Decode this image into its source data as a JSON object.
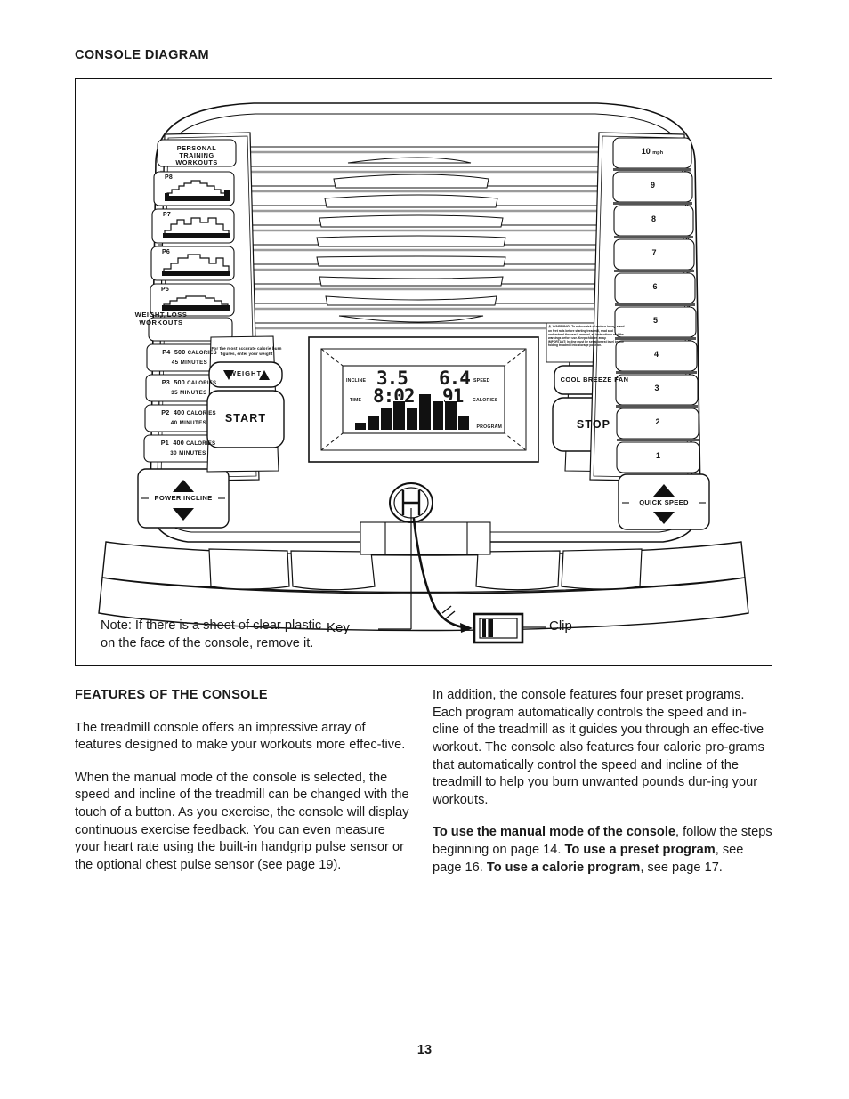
{
  "section_title": "CONSOLE DIAGRAM",
  "page_number": "13",
  "diagram": {
    "personal_training_header": "PERSONAL\nTRAINING\nWORKOUTS",
    "personal_training_header_lines": [
      "PERSONAL",
      "TRAINING",
      "WORKOUTS"
    ],
    "weight_loss_header_lines": [
      "WEIGHT LOSS",
      "WORKOUTS"
    ],
    "preset_programs": [
      {
        "id": "P8",
        "label": "P8"
      },
      {
        "id": "P7",
        "label": "P7"
      },
      {
        "id": "P6",
        "label": "P6"
      },
      {
        "id": "P5",
        "label": "P5"
      }
    ],
    "calorie_programs": [
      {
        "id": "P4",
        "calories": "500",
        "calories_word": "CALORIES",
        "minutes": "45 MINUTES"
      },
      {
        "id": "P3",
        "calories": "500",
        "calories_word": "CALORIES",
        "minutes": "35 MINUTES"
      },
      {
        "id": "P2",
        "calories": "400",
        "calories_word": "CALORIES",
        "minutes": "40 MINUTES"
      },
      {
        "id": "P1",
        "calories": "400",
        "calories_word": "CALORIES",
        "minutes": "30 MINUTES"
      }
    ],
    "power_incline_label": "POWER INCLINE",
    "quick_speed_label": "QUICK SPEED",
    "speed_buttons": [
      {
        "value": "10",
        "unit": "mph"
      },
      {
        "value": "9",
        "unit": ""
      },
      {
        "value": "8",
        "unit": ""
      },
      {
        "value": "7",
        "unit": ""
      },
      {
        "value": "6",
        "unit": ""
      },
      {
        "value": "5",
        "unit": ""
      },
      {
        "value": "4",
        "unit": ""
      },
      {
        "value": "3",
        "unit": ""
      },
      {
        "value": "2",
        "unit": ""
      },
      {
        "value": "1",
        "unit": ""
      }
    ],
    "weight_button_label": "WEIGHT",
    "weight_note": "For the most accurate calorie burn figures, enter your weight",
    "start_button_label": "START",
    "stop_button_label": "STOP",
    "cool_breeze_fan_label": "COOL BREEZE FAN",
    "warning_title": "WARNING:",
    "warning_text": "To reduce risk of serious injury, stand on feet rails before starting treadmill, read and understand the user's manual, all instructions and the warnings before use. Keep children away. IMPORTANT: Incline must be set at lowest level before folding treadmill into storage position.",
    "display": {
      "incline_label": "INCLINE",
      "incline_value": "3.5",
      "speed_label": "SPEED",
      "speed_value": "6.4",
      "time_label": "TIME",
      "time_value": "8:02",
      "calories_label": "CALORIES",
      "calories_value": "91",
      "program_label": "PROGRAM",
      "program_bars": [
        1,
        2,
        3,
        4,
        3,
        5,
        4,
        4,
        2
      ]
    },
    "callouts": {
      "key": "Key",
      "clip": "Clip"
    },
    "note_lines": [
      "Note: If there is a sheet of clear plastic",
      "on the face of the console, remove it."
    ]
  },
  "features": {
    "heading": "FEATURES OF THE CONSOLE",
    "left_paragraphs": [
      "The treadmill console offers an impressive array of features designed to make your workouts more effec-tive.",
      "When the manual mode of the console is selected, the speed and incline of the treadmill can be changed with the touch of a button. As you exercise, the console will display continuous exercise feedback. You can even measure your heart rate using the built-in handgrip pulse sensor or the optional chest pulse sensor (see page 19)."
    ],
    "right_paragraph_1": "In addition, the console features four preset programs. Each program automatically controls the speed and in-cline of the treadmill as it guides you through an effec-tive workout. The console also features four calorie pro-grams that automatically control the speed and incline of the treadmill to help you burn unwanted pounds dur-ing your workouts.",
    "right_paragraph_2": {
      "b1": "To use the manual mode of the console",
      "t1": ", follow the steps beginning on page 14. ",
      "b2": "To use a preset program",
      "t2": ", see page 16. ",
      "b3": "To use a calorie program",
      "t3": ", see page 17."
    }
  },
  "colors": {
    "ink": "#111111",
    "paper": "#ffffff",
    "shadow": "#666666"
  }
}
